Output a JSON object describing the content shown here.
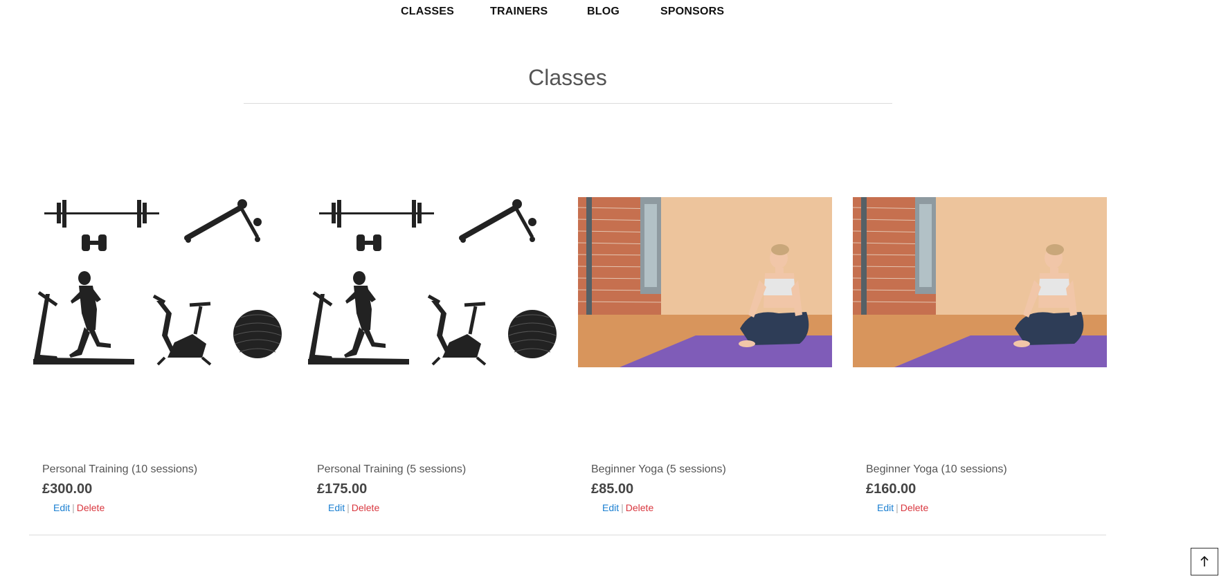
{
  "nav": {
    "classes": "CLASSES",
    "trainers": "TRAINERS",
    "blog": "BLOG",
    "sponsors": "SPONSORS"
  },
  "page": {
    "title": "Classes"
  },
  "products": [
    {
      "name": "Personal Training (10 sessions)",
      "price": "£300.00",
      "edit": "Edit",
      "sep": "|",
      "delete": "Delete",
      "image": "gym-equipment-icons"
    },
    {
      "name": "Personal Training (5 sessions)",
      "price": "£175.00",
      "edit": "Edit",
      "sep": "|",
      "delete": "Delete",
      "image": "gym-equipment-icons"
    },
    {
      "name": "Beginner Yoga (5 sessions)",
      "price": "£85.00",
      "edit": "Edit",
      "sep": "|",
      "delete": "Delete",
      "image": "yoga-photo"
    },
    {
      "name": "Beginner Yoga (10 sessions)",
      "price": "£160.00",
      "edit": "Edit",
      "sep": "|",
      "delete": "Delete",
      "image": "yoga-photo"
    }
  ],
  "back_to_top": {
    "icon": "arrow-up-icon"
  },
  "colors": {
    "edit_link": "#1a7fd1",
    "delete_link": "#d9363e",
    "rule": "#dcdcdc"
  }
}
